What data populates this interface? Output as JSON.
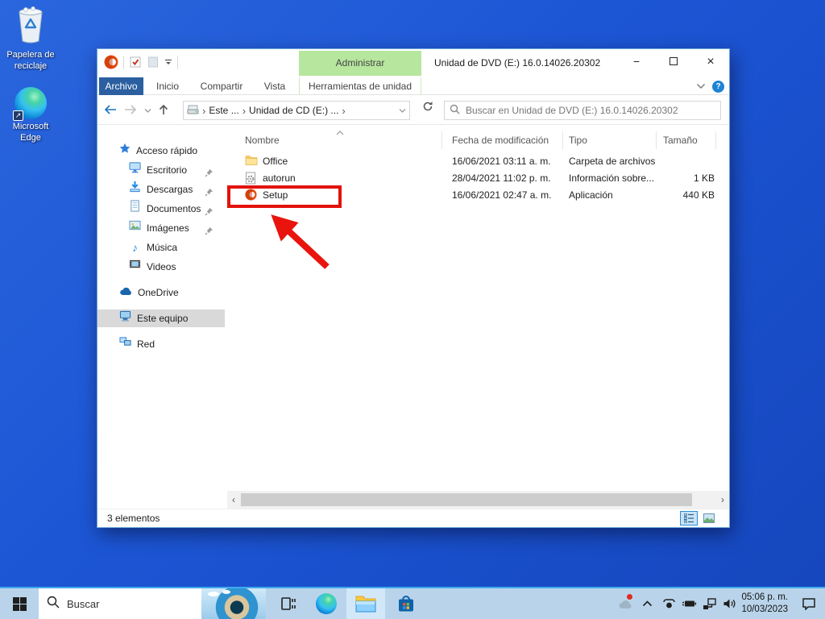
{
  "colors": {
    "desktop_blue": "#1c55d4",
    "taskbar_blue": "#b9d4ea",
    "accent_blue": "#2b5fa0",
    "contextual_tab_green": "#b7e69e",
    "annotation_red": "#e3120b",
    "sidebar_selection_gray": "#d9d9d9",
    "office_orange": "#e8490f"
  },
  "desktop": {
    "icons": [
      {
        "label": "Papelera de reciclaje"
      },
      {
        "label": "Microsoft Edge"
      }
    ]
  },
  "window": {
    "title": "Unidad de DVD (E:) 16.0.14026.20302",
    "contextual_tab": "Administrar",
    "tool_tab": "Herramientas de unidad",
    "tabs": [
      {
        "label": "Archivo"
      },
      {
        "label": "Inicio"
      },
      {
        "label": "Compartir"
      },
      {
        "label": "Vista"
      }
    ],
    "help_label": "?",
    "nav": {
      "breadcrumb_1": "Este ...",
      "breadcrumb_2": "Unidad de CD (E:) ...",
      "search_placeholder": "Buscar en Unidad de DVD (E:) 16.0.14026.20302"
    },
    "sidebar": {
      "items": [
        {
          "label": "Acceso rápido"
        },
        {
          "label": "Escritorio"
        },
        {
          "label": "Descargas"
        },
        {
          "label": "Documentos"
        },
        {
          "label": "Imágenes"
        },
        {
          "label": "Música"
        },
        {
          "label": "Videos"
        },
        {
          "label": "OneDrive"
        },
        {
          "label": "Este equipo"
        },
        {
          "label": "Red"
        }
      ]
    },
    "files": {
      "columns": [
        {
          "label": "Nombre"
        },
        {
          "label": "Fecha de modificación"
        },
        {
          "label": "Tipo"
        },
        {
          "label": "Tamaño"
        }
      ],
      "rows": [
        {
          "name": "Office",
          "date": "16/06/2021 03:11 a. m.",
          "type": "Carpeta de archivos",
          "size": ""
        },
        {
          "name": "autorun",
          "date": "28/04/2021 11:02 p. m.",
          "type": "Información sobre...",
          "size": "1 KB"
        },
        {
          "name": "Setup",
          "date": "16/06/2021 02:47 a. m.",
          "type": "Aplicación",
          "size": "440 KB"
        }
      ]
    },
    "status": {
      "items_count": "3 elementos"
    }
  },
  "taskbar": {
    "search_placeholder": "Buscar",
    "clock": {
      "time": "05:06 p. m.",
      "date": "10/03/2023"
    }
  }
}
